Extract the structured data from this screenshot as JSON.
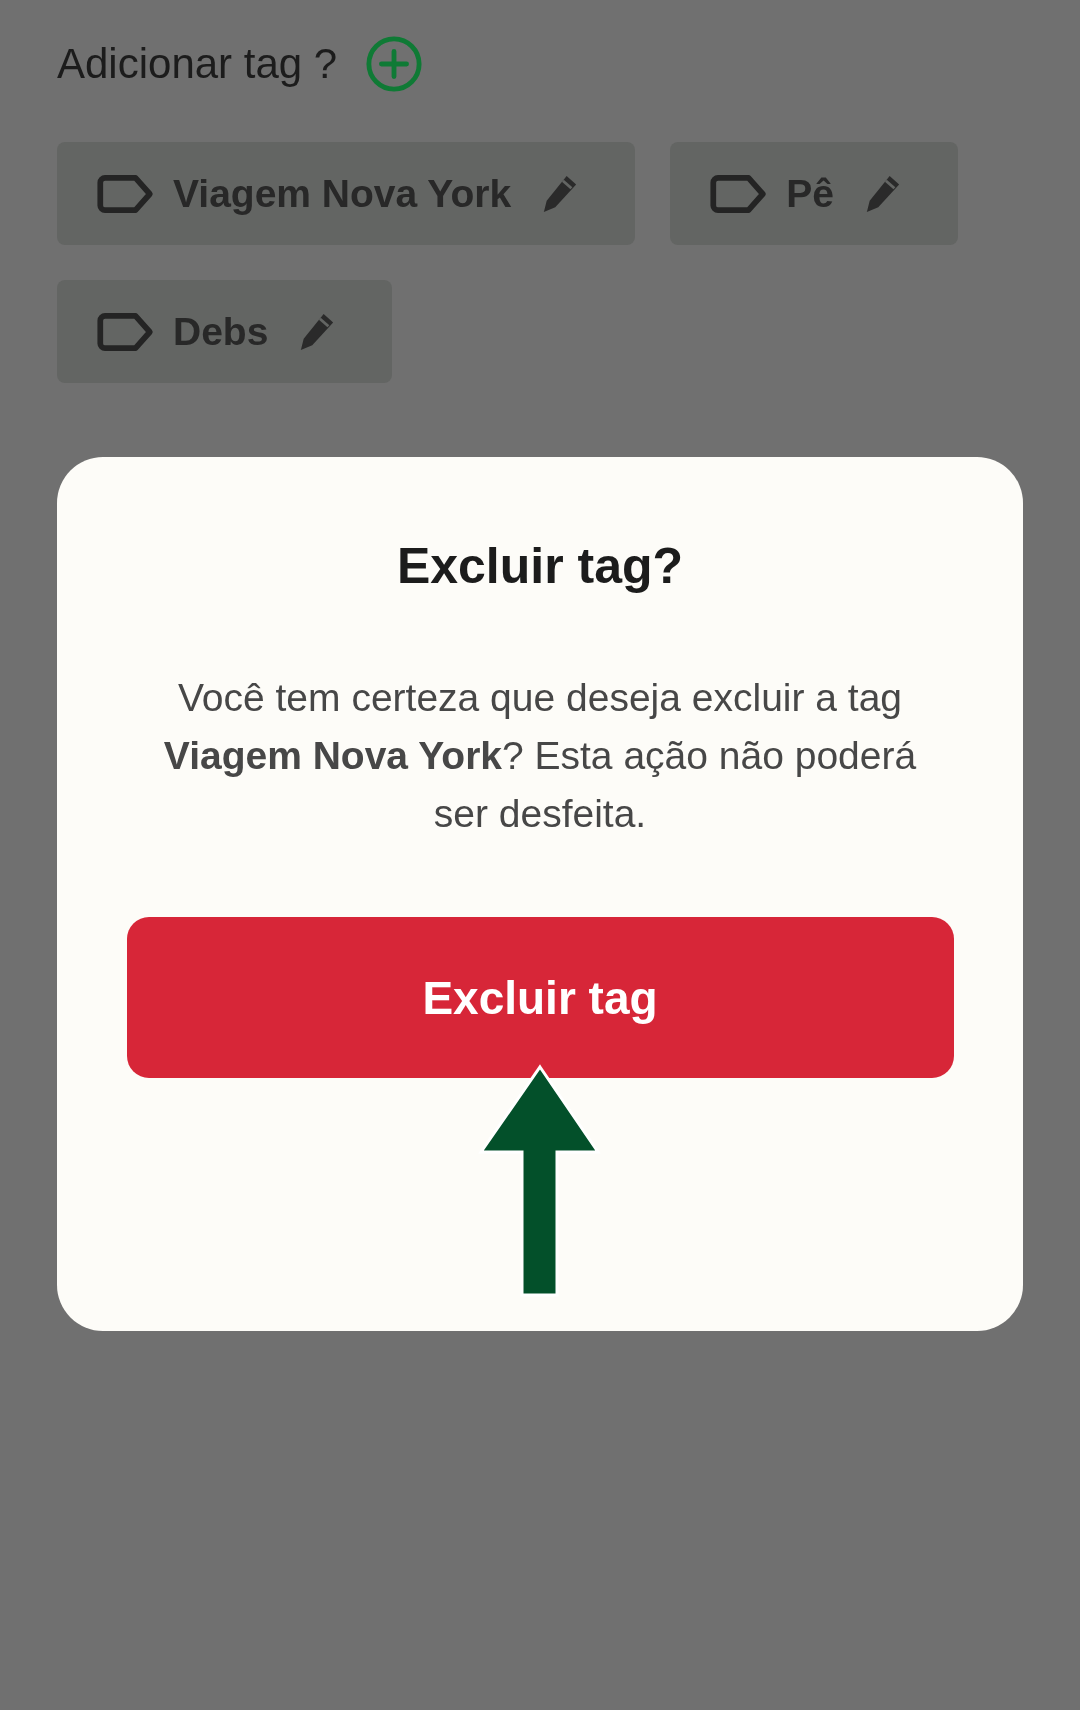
{
  "header": {
    "title": "Adicionar tag ?"
  },
  "tags": [
    {
      "label": "Viagem Nova York"
    },
    {
      "label": "Pê"
    },
    {
      "label": "Debs"
    }
  ],
  "dialog": {
    "title": "Excluir tag?",
    "message": "Você tem certeza que deseja excluir a tag **Viagem Nova York**? Esta ação não poderá ser desfeita.",
    "button": "Excluir tag"
  }
}
